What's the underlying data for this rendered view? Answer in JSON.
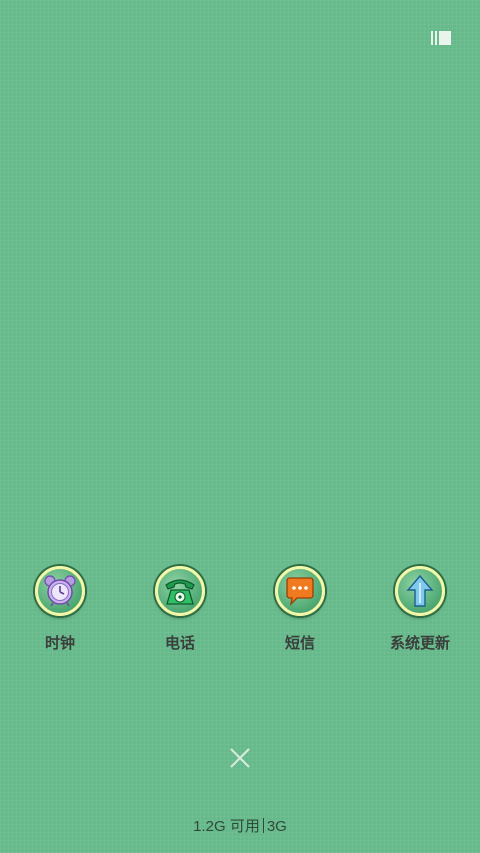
{
  "recents": {
    "multi_window_icon": "multi-window-icon",
    "close_icon": "close-icon"
  },
  "apps": [
    {
      "label": "时钟",
      "icon": "alarm-clock-icon"
    },
    {
      "label": "电话",
      "icon": "phone-icon"
    },
    {
      "label": "短信",
      "icon": "message-icon"
    },
    {
      "label": "系统更新",
      "icon": "upload-arrow-icon"
    }
  ],
  "memory": {
    "available": "1.2G 可用",
    "total": "3G"
  },
  "colors": {
    "background": "#66b98a",
    "icon_ring": "#f3f7a8",
    "label_text": "#3a3f3c",
    "close_x": "#d9ece0"
  }
}
